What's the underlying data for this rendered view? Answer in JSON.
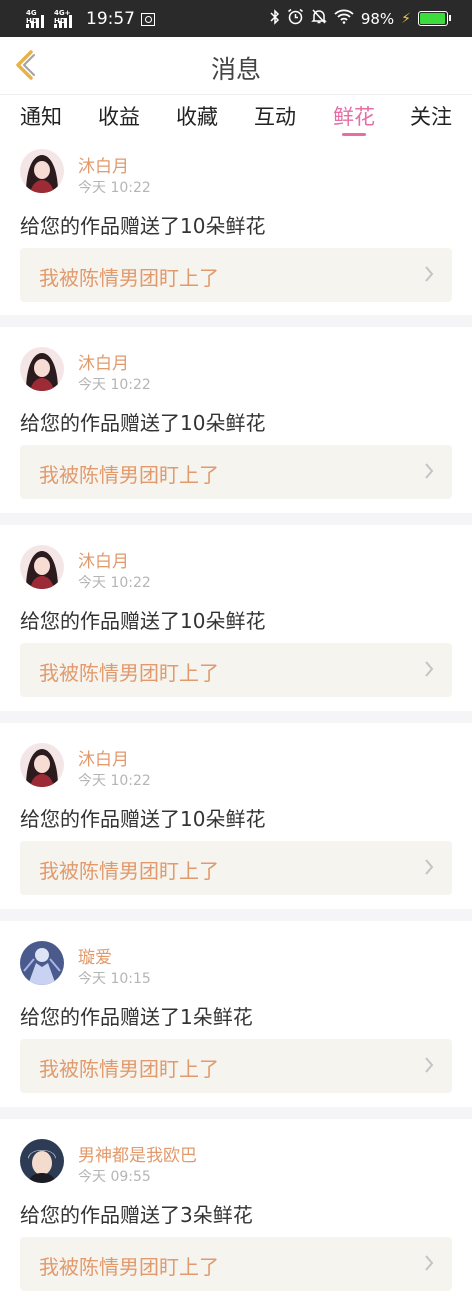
{
  "status_bar": {
    "network_1": "4G HD",
    "network_2": "4G+ HD",
    "time": "19:57",
    "battery": "98%",
    "battery_level": 0.98
  },
  "nav": {
    "title": "消息",
    "back_icon": "chevron-left-icon"
  },
  "tabs": [
    {
      "label": "通知",
      "active": false
    },
    {
      "label": "收益",
      "active": false
    },
    {
      "label": "收藏",
      "active": false
    },
    {
      "label": "互动",
      "active": false
    },
    {
      "label": "鲜花",
      "active": true
    },
    {
      "label": "关注",
      "active": false
    }
  ],
  "notifications": [
    {
      "user": "沐白月",
      "time": "今天 10:22",
      "message": "给您的作品赠送了10朵鲜花",
      "work": "我被陈情男团盯上了"
    },
    {
      "user": "沐白月",
      "time": "今天 10:22",
      "message": "给您的作品赠送了10朵鲜花",
      "work": "我被陈情男团盯上了"
    },
    {
      "user": "沐白月",
      "time": "今天 10:22",
      "message": "给您的作品赠送了10朵鲜花",
      "work": "我被陈情男团盯上了"
    },
    {
      "user": "沐白月",
      "time": "今天 10:22",
      "message": "给您的作品赠送了10朵鲜花",
      "work": "我被陈情男团盯上了"
    },
    {
      "user": "璇爱",
      "time": "今天 10:15",
      "message": "给您的作品赠送了1朵鲜花",
      "work": "我被陈情男团盯上了"
    },
    {
      "user": "男神都是我欧巴",
      "time": "今天 09:55",
      "message": "给您的作品赠送了3朵鲜花",
      "work": "我被陈情男团盯上了"
    }
  ],
  "colors": {
    "accent_pink": "#e56fa4",
    "username_orange": "#e29a6c",
    "status_bar_bg": "#2a2a2a",
    "link_box_bg": "#f5f4ef",
    "back_arrow": "#e8b24a"
  }
}
